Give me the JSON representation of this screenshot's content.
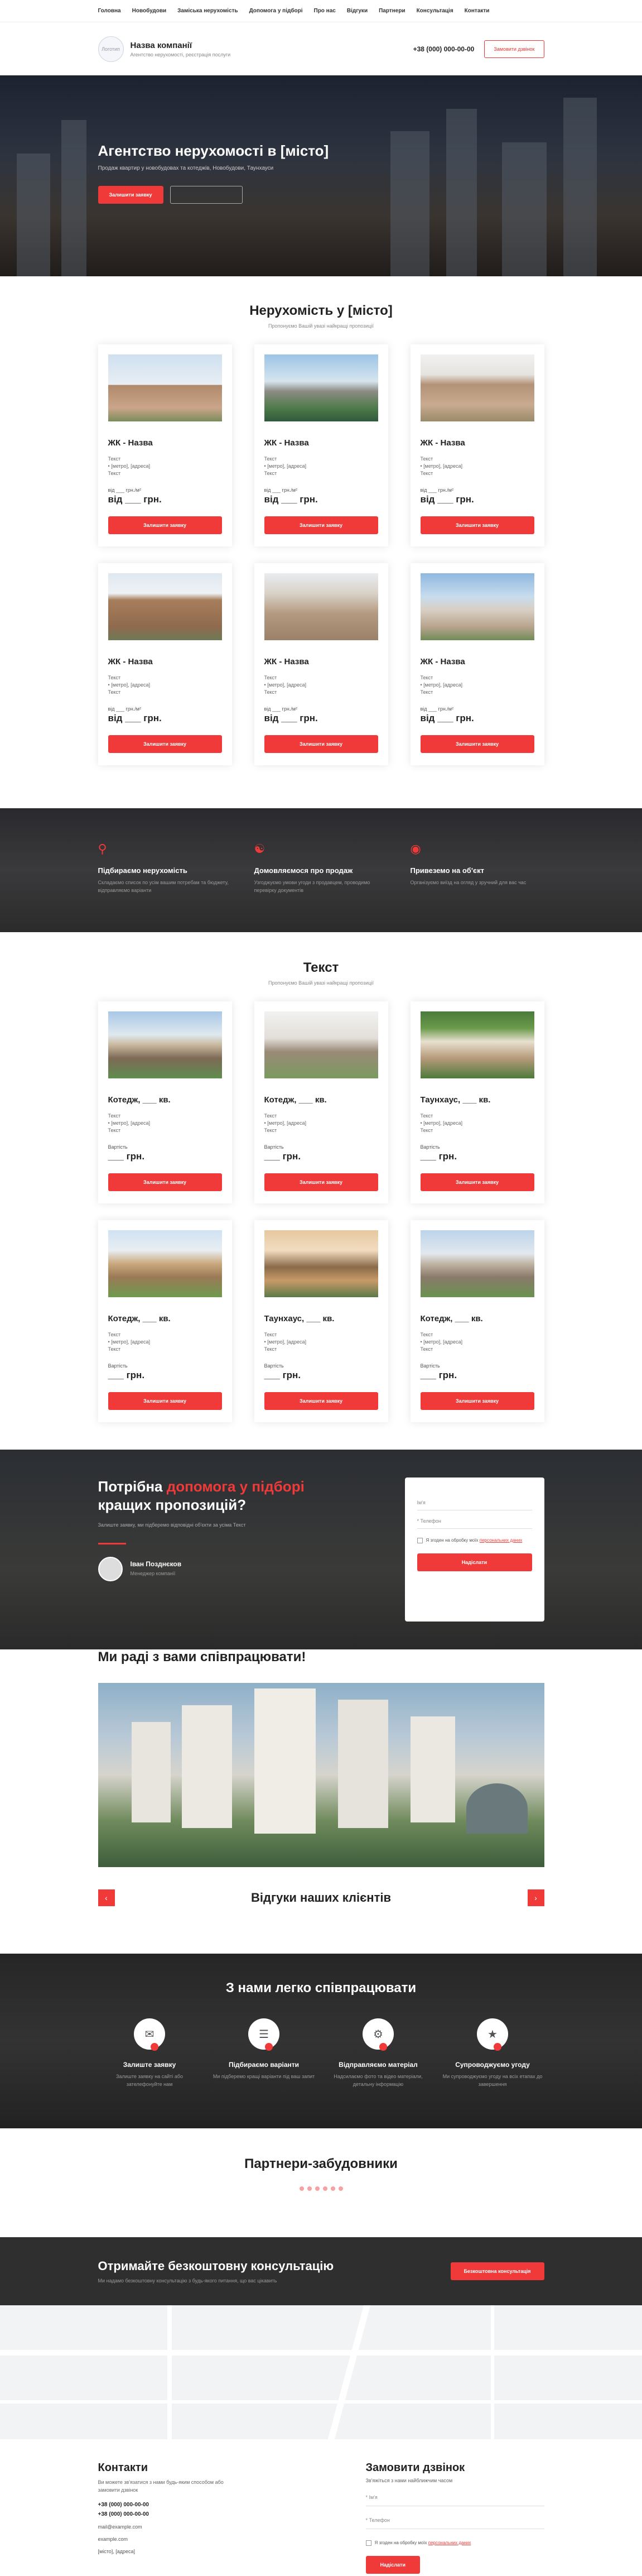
{
  "nav": [
    "Головна",
    "Новобудови",
    "Заміська нерухомість",
    "Допомога у підборі",
    "Про нас",
    "Відгуки",
    "Партнери",
    "Консультація",
    "Контакти"
  ],
  "header": {
    "logo_text": "Логотип",
    "company": "Назва компанії",
    "tagline": "Агентство нерухомості, реєстрація послуги",
    "phone": "+38 (000) 000-00-00",
    "callback": "Замовити дзвінок"
  },
  "hero": {
    "title": "Агентство нерухомості в [місто]",
    "subtitle": "Продаж квартир у новобудовах та котеджів, Новобудови, Таунхауси",
    "btn_primary": "Залишити заявку",
    "btn_secondary": ""
  },
  "section1": {
    "title": "Нерухомість у [місто]",
    "subtitle": "Пропонуємо Вашій увазі найкращі пропозиції",
    "cards": [
      {
        "name": "ЖК - Назва",
        "desc": "Текст\n• [метро], [адреса]\nТекст",
        "from": "від ___ грн./м²",
        "price": "від ___ грн.",
        "btn": "Залишити заявку"
      },
      {
        "name": "ЖК - Назва",
        "desc": "Текст\n• [метро], [адреса]\nТекст",
        "from": "від ___ грн./м²",
        "price": "від ___ грн.",
        "btn": "Залишити заявку"
      },
      {
        "name": "ЖК - Назва",
        "desc": "Текст\n• [метро], [адреса]\nТекст",
        "from": "від ___ грн./м²",
        "price": "від ___ грн.",
        "btn": "Залишити заявку"
      },
      {
        "name": "ЖК - Назва",
        "desc": "Текст\n• [метро], [адреса]\nТекст",
        "from": "від ___ грн./м²",
        "price": "від ___ грн.",
        "btn": "Залишити заявку"
      },
      {
        "name": "ЖК - Назва",
        "desc": "Текст\n• [метро], [адреса]\nТекст",
        "from": "від ___ грн./м²",
        "price": "від ___ грн.",
        "btn": "Залишити заявку"
      },
      {
        "name": "ЖК - Назва",
        "desc": "Текст\n• [метро], [адреса]\nТекст",
        "from": "від ___ грн./м²",
        "price": "від ___ грн.",
        "btn": "Залишити заявку"
      }
    ]
  },
  "features": [
    {
      "title": "Підбираємо нерухомість",
      "text": "Складаємо список по усім вашим потребам та бюджету, відправляємо варіанти"
    },
    {
      "title": "Домовляємося про продаж",
      "text": "Узгоджуємо умови угоди з продавцем, проводимо перевірку документів"
    },
    {
      "title": "Привеземо на об'єкт",
      "text": "Організуємо виїзд на огляд у зручний для вас час"
    }
  ],
  "section2": {
    "title": "Текст",
    "subtitle": "Пропонуємо Вашій увазі найкращі пропозиції",
    "cards": [
      {
        "name": "Котедж, ___ кв.",
        "desc": "Текст\n• [метро], [адреса]\nТекст",
        "from": "Вартість",
        "price": "___ грн.",
        "btn": "Залишити заявку"
      },
      {
        "name": "Котедж, ___ кв.",
        "desc": "Текст\n• [метро], [адреса]\nТекст",
        "from": "Вартість",
        "price": "___ грн.",
        "btn": "Залишити заявку"
      },
      {
        "name": "Таунхаус, ___ кв.",
        "desc": "Текст\n• [метро], [адреса]\nТекст",
        "from": "Вартість",
        "price": "___ грн.",
        "btn": "Залишити заявку"
      },
      {
        "name": "Котедж, ___ кв.",
        "desc": "Текст\n• [метро], [адреса]\nТекст",
        "from": "Вартість",
        "price": "___ грн.",
        "btn": "Залишити заявку"
      },
      {
        "name": "Таунхаус, ___ кв.",
        "desc": "Текст\n• [метро], [адреса]\nТекст",
        "from": "Вартість",
        "price": "___ грн.",
        "btn": "Залишити заявку"
      },
      {
        "name": "Котедж, ___ кв.",
        "desc": "Текст\n• [метро], [адреса]\nТекст",
        "from": "Вартість",
        "price": "___ грн.",
        "btn": "Залишити заявку"
      }
    ]
  },
  "help": {
    "title_a": "Потрібна ",
    "title_hl": "допомога у підборі",
    "title_b": " кращих пропозицій?",
    "intro": "Залиште заявку, ми підберемо відповідні об'єкти за усіма Текст",
    "manager_name": "Іван Позднєков",
    "manager_role": "Менеджер компанії",
    "form": {
      "name_ph": "Ім'я",
      "phone_ph": "* Телефон",
      "consent": "Я згоден на обробку моїх ",
      "consent_link": "персональних даних",
      "submit": "Надіслати"
    }
  },
  "partners_photo_title": "Ми раді з вами співпрацювати!",
  "reviews": {
    "title": "Відгуки наших клієнтів",
    "prev": "‹",
    "next": "›"
  },
  "easy": {
    "title": "З нами легко співпрацювати",
    "steps": [
      {
        "title": "Залиште заявку",
        "text": "Залиште заявку на сайті або зателефонуйте нам"
      },
      {
        "title": "Підбираємо варіанти",
        "text": "Ми підберемо кращі варіанти під ваш запит"
      },
      {
        "title": "Відправляємо матеріал",
        "text": "Надсилаємо фото та відео матеріали, детальну інформацію"
      },
      {
        "title": "Супроводжуємо угоду",
        "text": "Ми супроводжуємо угоду на всіх етапах до завершення"
      }
    ]
  },
  "developers": {
    "title": "Партнери-забудовники"
  },
  "consult": {
    "title": "Отримайте безкоштовну консультацію",
    "text": "Ми надамо безкоштовну консультацію з будь-якого питання, що вас цікавить",
    "btn": "Безкоштовна консультація"
  },
  "contacts": {
    "title": "Контакти",
    "text": "Ви можете зв'язатися з нами будь-яким способом або замовити дзвінок",
    "phone1": "+38 (000) 000-00-00",
    "phone2": "+38 (000) 000-00-00",
    "email": "mail@example.com",
    "site": "example.com",
    "address": "[місто], [адреса]"
  },
  "callback": {
    "title": "Замовити дзвінок",
    "subtitle": "Зв'яжіться з нами найближчим часом",
    "name_ph": "* Ім'я",
    "phone_ph": "* Телефон",
    "consent": "Я згоден на обробку моїх ",
    "consent_link": "персональних даних",
    "submit": "Надіслати"
  }
}
